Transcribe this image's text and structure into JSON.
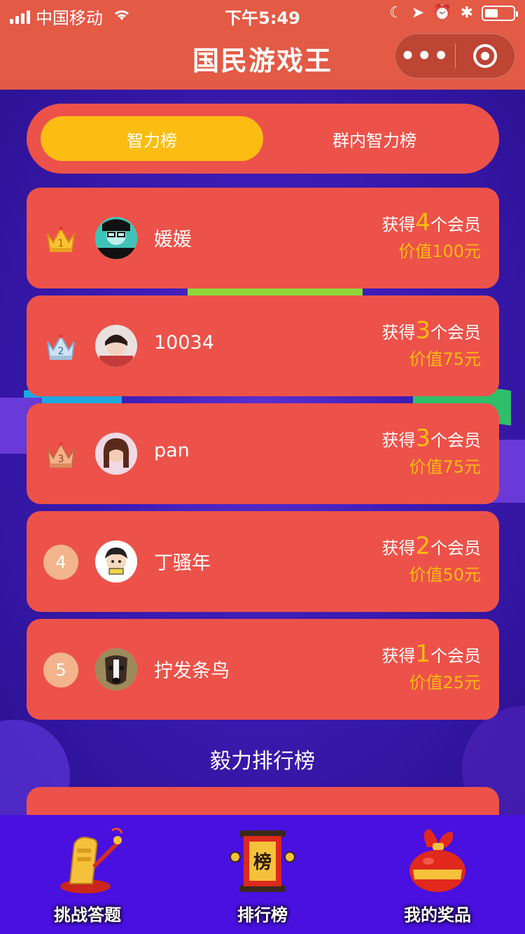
{
  "status_bar": {
    "carrier": "中国移动",
    "time": "下午5:49"
  },
  "header": {
    "title": "国民游戏王",
    "more_icon": "more-dots-icon",
    "close_icon": "target-icon"
  },
  "tabs": [
    {
      "label": "智力榜",
      "active": true
    },
    {
      "label": "群内智力榜",
      "active": false
    }
  ],
  "rankings": [
    {
      "rank": "1",
      "badge": "gold-crown",
      "name": "媛媛",
      "prefix": "获得",
      "count": "4",
      "suffix": "个会员",
      "value": "价值100元"
    },
    {
      "rank": "2",
      "badge": "silver-crown",
      "name": "10034",
      "prefix": "获得",
      "count": "3",
      "suffix": "个会员",
      "value": "价值75元"
    },
    {
      "rank": "3",
      "badge": "bronze-crown",
      "name": "pan",
      "prefix": "获得",
      "count": "3",
      "suffix": "个会员",
      "value": "价值75元"
    },
    {
      "rank": "4",
      "badge": "number",
      "name": "丁骚年",
      "prefix": "获得",
      "count": "2",
      "suffix": "个会员",
      "value": "价值50元"
    },
    {
      "rank": "5",
      "badge": "number",
      "name": "拧发条鸟",
      "prefix": "获得",
      "count": "1",
      "suffix": "个会员",
      "value": "价值25元"
    }
  ],
  "section_title": "毅力排行榜",
  "bottom_nav": [
    {
      "label": "挑战答题",
      "icon": "challenge-icon"
    },
    {
      "label": "排行榜",
      "icon": "ranking-scroll-icon",
      "icon_text": "榜"
    },
    {
      "label": "我的奖品",
      "icon": "prize-bag-icon"
    }
  ],
  "colors": {
    "header": "#e35a45",
    "card": "#ec5249",
    "accent": "#fcbd12",
    "background": "#3a1bb0",
    "nav": "#4a10e0"
  }
}
